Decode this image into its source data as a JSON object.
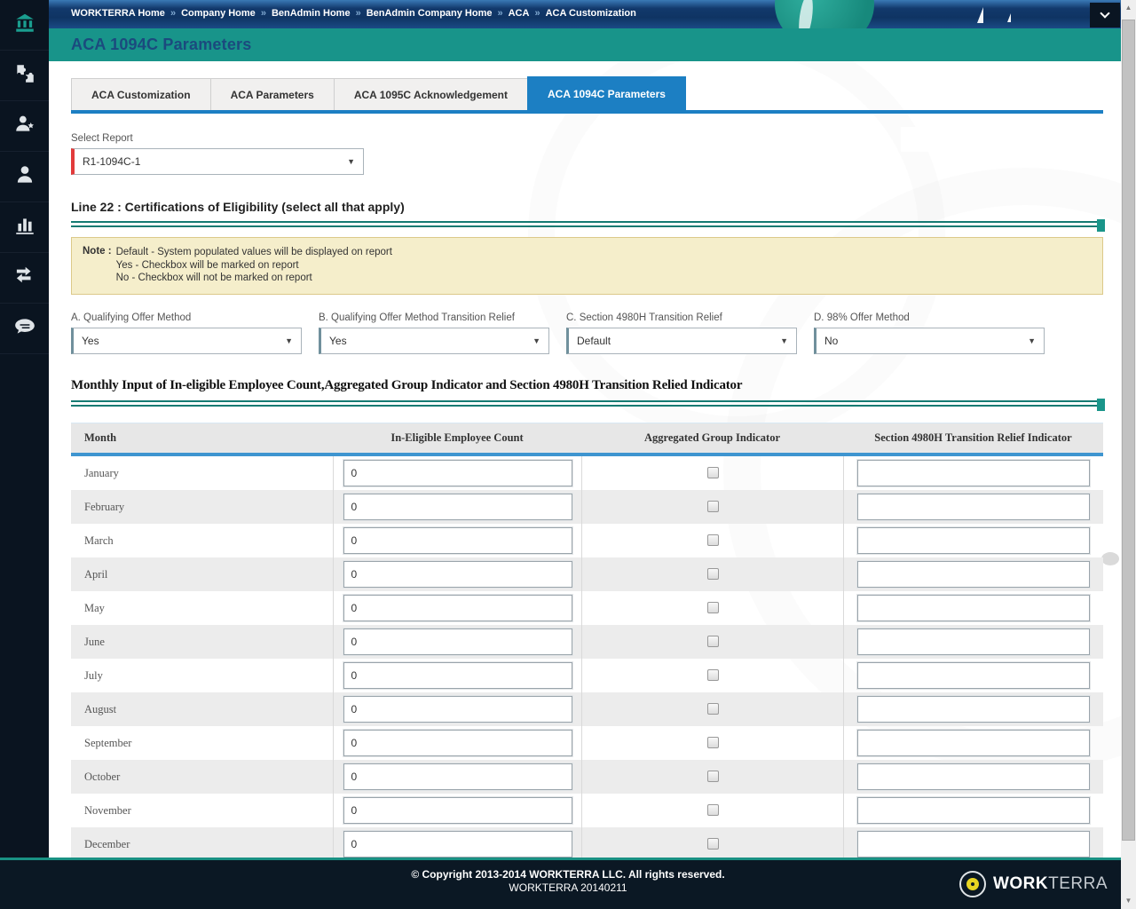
{
  "colors": {
    "accent_blue": "#1c7fc3",
    "teal_band": "#18948a",
    "sidebar_bg": "#0a1420",
    "note_bg": "#f5eecb",
    "note_border": "#dcc98a",
    "required_red": "#e23b3b",
    "footer_bg": "#0b1824",
    "table_header_bg": "#e7e7e7",
    "row_alt_bg": "#ececec",
    "blue_bar": "#3e95d0"
  },
  "icons": {
    "dropdown_arrow": "▼",
    "scroll_up": "▲",
    "scroll_down": "▼",
    "breadcrumb_separator": "»"
  },
  "sidebar": {
    "items": [
      {
        "name": "home",
        "active": true
      },
      {
        "name": "puzzle",
        "active": false
      },
      {
        "name": "person-star",
        "active": false
      },
      {
        "name": "person",
        "active": false
      },
      {
        "name": "bar-chart",
        "active": false
      },
      {
        "name": "transfer-arrows",
        "active": false
      },
      {
        "name": "chat",
        "active": false
      }
    ]
  },
  "breadcrumb": {
    "separator": "»",
    "items": [
      "WORKTERRA Home",
      "Company Home",
      "BenAdmin Home",
      "BenAdmin Company Home",
      "ACA",
      "ACA Customization"
    ]
  },
  "header": {
    "title": "ACA 1094C Parameters"
  },
  "tabs": [
    {
      "label": "ACA Customization",
      "active": false
    },
    {
      "label": "ACA Parameters",
      "active": false
    },
    {
      "label": "ACA 1095C Acknowledgement",
      "active": false
    },
    {
      "label": "ACA 1094C Parameters",
      "active": true
    }
  ],
  "report": {
    "label": "Select Report",
    "value": "R1-1094C-1"
  },
  "line22": {
    "heading": "Line 22 : Certifications of Eligibility (select all that apply)"
  },
  "note": {
    "label": "Note :",
    "lines": [
      "Default - System populated values will be displayed on report",
      "Yes - Checkbox will be marked on report",
      "No - Checkbox will not be marked on report"
    ]
  },
  "certifications": [
    {
      "label": "A. Qualifying Offer Method",
      "value": "Yes"
    },
    {
      "label": "B. Qualifying Offer Method Transition Relief",
      "value": "Yes"
    },
    {
      "label": "C. Section 4980H Transition Relief",
      "value": "Default"
    },
    {
      "label": "D. 98% Offer Method",
      "value": "No"
    }
  ],
  "monthly": {
    "heading": "Monthly Input of In-eligible Employee Count,Aggregated Group Indicator and Section 4980H Transition Relied Indicator",
    "columns": [
      "Month",
      "In-Eligible Employee Count",
      "Aggregated Group Indicator",
      "Section 4980H Transition Relief Indicator"
    ],
    "rows": [
      {
        "month": "January",
        "count": "0",
        "aggregated": false,
        "indicator": ""
      },
      {
        "month": "February",
        "count": "0",
        "aggregated": false,
        "indicator": ""
      },
      {
        "month": "March",
        "count": "0",
        "aggregated": false,
        "indicator": ""
      },
      {
        "month": "April",
        "count": "0",
        "aggregated": false,
        "indicator": ""
      },
      {
        "month": "May",
        "count": "0",
        "aggregated": false,
        "indicator": ""
      },
      {
        "month": "June",
        "count": "0",
        "aggregated": false,
        "indicator": ""
      },
      {
        "month": "July",
        "count": "0",
        "aggregated": false,
        "indicator": ""
      },
      {
        "month": "August",
        "count": "0",
        "aggregated": false,
        "indicator": ""
      },
      {
        "month": "September",
        "count": "0",
        "aggregated": false,
        "indicator": ""
      },
      {
        "month": "October",
        "count": "0",
        "aggregated": false,
        "indicator": ""
      },
      {
        "month": "November",
        "count": "0",
        "aggregated": false,
        "indicator": ""
      },
      {
        "month": "December",
        "count": "0",
        "aggregated": false,
        "indicator": ""
      }
    ]
  },
  "footer": {
    "copyright": "© Copyright 2013-2014 WORKTERRA LLC. All rights reserved.",
    "version": "WORKTERRA 20140211",
    "logo_bold": "WORK",
    "logo_light": "TERRA"
  }
}
